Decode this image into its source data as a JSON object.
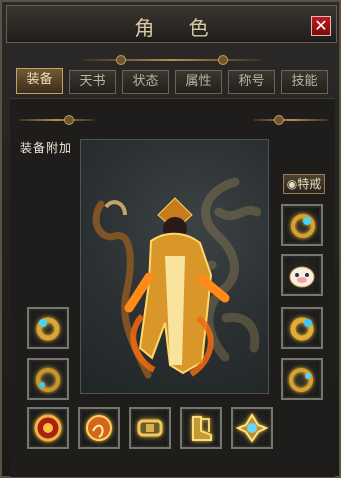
{
  "window": {
    "title": "角 色",
    "close_label": "✕"
  },
  "tabs": [
    {
      "label": "装备",
      "active": true
    },
    {
      "label": "天书",
      "active": false
    },
    {
      "label": "状态",
      "active": false
    },
    {
      "label": "属性",
      "active": false
    },
    {
      "label": "称号",
      "active": false
    },
    {
      "label": "技能",
      "active": false
    }
  ],
  "equipment": {
    "section_label": "装备附加",
    "special_button": "特戒"
  },
  "colors": {
    "panel_border": "#5b5244",
    "active_tab": "#6f5a35",
    "item_glow": "#ffbf2a",
    "close": "#c01919"
  }
}
